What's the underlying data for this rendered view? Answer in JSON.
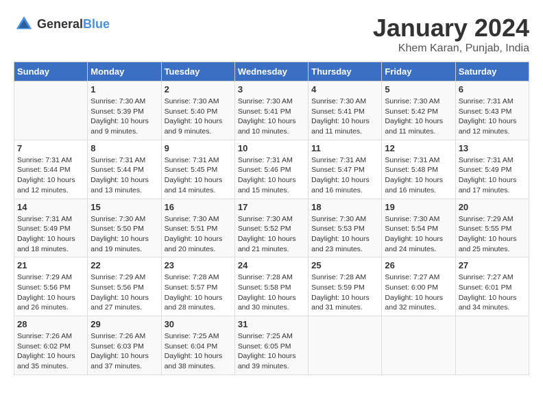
{
  "header": {
    "logo": {
      "general": "General",
      "blue": "Blue"
    },
    "title": "January 2024",
    "location": "Khem Karan, Punjab, India"
  },
  "calendar": {
    "days_of_week": [
      "Sunday",
      "Monday",
      "Tuesday",
      "Wednesday",
      "Thursday",
      "Friday",
      "Saturday"
    ],
    "weeks": [
      [
        {
          "day": "",
          "info": ""
        },
        {
          "day": "1",
          "info": "Sunrise: 7:30 AM\nSunset: 5:39 PM\nDaylight: 10 hours\nand 9 minutes."
        },
        {
          "day": "2",
          "info": "Sunrise: 7:30 AM\nSunset: 5:40 PM\nDaylight: 10 hours\nand 9 minutes."
        },
        {
          "day": "3",
          "info": "Sunrise: 7:30 AM\nSunset: 5:41 PM\nDaylight: 10 hours\nand 10 minutes."
        },
        {
          "day": "4",
          "info": "Sunrise: 7:30 AM\nSunset: 5:41 PM\nDaylight: 10 hours\nand 11 minutes."
        },
        {
          "day": "5",
          "info": "Sunrise: 7:30 AM\nSunset: 5:42 PM\nDaylight: 10 hours\nand 11 minutes."
        },
        {
          "day": "6",
          "info": "Sunrise: 7:31 AM\nSunset: 5:43 PM\nDaylight: 10 hours\nand 12 minutes."
        }
      ],
      [
        {
          "day": "7",
          "info": "Sunrise: 7:31 AM\nSunset: 5:44 PM\nDaylight: 10 hours\nand 12 minutes."
        },
        {
          "day": "8",
          "info": "Sunrise: 7:31 AM\nSunset: 5:44 PM\nDaylight: 10 hours\nand 13 minutes."
        },
        {
          "day": "9",
          "info": "Sunrise: 7:31 AM\nSunset: 5:45 PM\nDaylight: 10 hours\nand 14 minutes."
        },
        {
          "day": "10",
          "info": "Sunrise: 7:31 AM\nSunset: 5:46 PM\nDaylight: 10 hours\nand 15 minutes."
        },
        {
          "day": "11",
          "info": "Sunrise: 7:31 AM\nSunset: 5:47 PM\nDaylight: 10 hours\nand 16 minutes."
        },
        {
          "day": "12",
          "info": "Sunrise: 7:31 AM\nSunset: 5:48 PM\nDaylight: 10 hours\nand 16 minutes."
        },
        {
          "day": "13",
          "info": "Sunrise: 7:31 AM\nSunset: 5:49 PM\nDaylight: 10 hours\nand 17 minutes."
        }
      ],
      [
        {
          "day": "14",
          "info": "Sunrise: 7:31 AM\nSunset: 5:49 PM\nDaylight: 10 hours\nand 18 minutes."
        },
        {
          "day": "15",
          "info": "Sunrise: 7:30 AM\nSunset: 5:50 PM\nDaylight: 10 hours\nand 19 minutes."
        },
        {
          "day": "16",
          "info": "Sunrise: 7:30 AM\nSunset: 5:51 PM\nDaylight: 10 hours\nand 20 minutes."
        },
        {
          "day": "17",
          "info": "Sunrise: 7:30 AM\nSunset: 5:52 PM\nDaylight: 10 hours\nand 21 minutes."
        },
        {
          "day": "18",
          "info": "Sunrise: 7:30 AM\nSunset: 5:53 PM\nDaylight: 10 hours\nand 23 minutes."
        },
        {
          "day": "19",
          "info": "Sunrise: 7:30 AM\nSunset: 5:54 PM\nDaylight: 10 hours\nand 24 minutes."
        },
        {
          "day": "20",
          "info": "Sunrise: 7:29 AM\nSunset: 5:55 PM\nDaylight: 10 hours\nand 25 minutes."
        }
      ],
      [
        {
          "day": "21",
          "info": "Sunrise: 7:29 AM\nSunset: 5:56 PM\nDaylight: 10 hours\nand 26 minutes."
        },
        {
          "day": "22",
          "info": "Sunrise: 7:29 AM\nSunset: 5:56 PM\nDaylight: 10 hours\nand 27 minutes."
        },
        {
          "day": "23",
          "info": "Sunrise: 7:28 AM\nSunset: 5:57 PM\nDaylight: 10 hours\nand 28 minutes."
        },
        {
          "day": "24",
          "info": "Sunrise: 7:28 AM\nSunset: 5:58 PM\nDaylight: 10 hours\nand 30 minutes."
        },
        {
          "day": "25",
          "info": "Sunrise: 7:28 AM\nSunset: 5:59 PM\nDaylight: 10 hours\nand 31 minutes."
        },
        {
          "day": "26",
          "info": "Sunrise: 7:27 AM\nSunset: 6:00 PM\nDaylight: 10 hours\nand 32 minutes."
        },
        {
          "day": "27",
          "info": "Sunrise: 7:27 AM\nSunset: 6:01 PM\nDaylight: 10 hours\nand 34 minutes."
        }
      ],
      [
        {
          "day": "28",
          "info": "Sunrise: 7:26 AM\nSunset: 6:02 PM\nDaylight: 10 hours\nand 35 minutes."
        },
        {
          "day": "29",
          "info": "Sunrise: 7:26 AM\nSunset: 6:03 PM\nDaylight: 10 hours\nand 37 minutes."
        },
        {
          "day": "30",
          "info": "Sunrise: 7:25 AM\nSunset: 6:04 PM\nDaylight: 10 hours\nand 38 minutes."
        },
        {
          "day": "31",
          "info": "Sunrise: 7:25 AM\nSunset: 6:05 PM\nDaylight: 10 hours\nand 39 minutes."
        },
        {
          "day": "",
          "info": ""
        },
        {
          "day": "",
          "info": ""
        },
        {
          "day": "",
          "info": ""
        }
      ]
    ]
  }
}
